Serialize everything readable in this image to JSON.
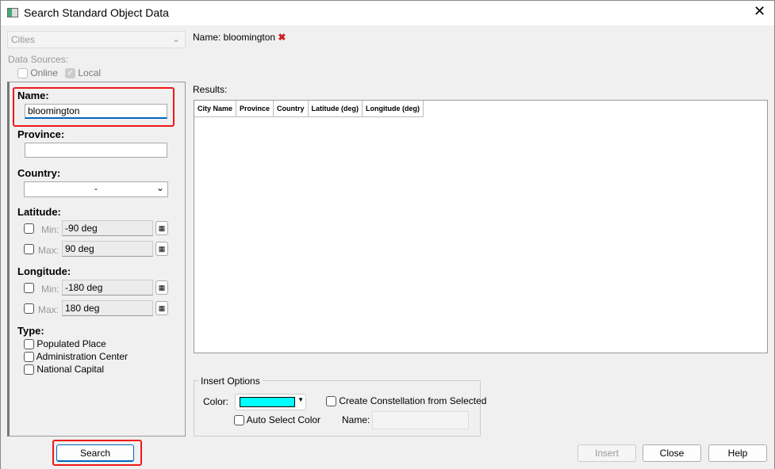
{
  "window": {
    "title": "Search Standard Object Data"
  },
  "category": {
    "selected": "Cities"
  },
  "data_sources": {
    "label": "Data Sources:",
    "online": "Online",
    "local": "Local",
    "local_checked": true,
    "online_checked": false
  },
  "form": {
    "name_label": "Name:",
    "name_value": "bloomington",
    "province_label": "Province:",
    "province_value": "",
    "country_label": "Country:",
    "country_value": "-",
    "latitude_label": "Latitude:",
    "min_label": "Min:",
    "max_label": "Max:",
    "lat_min": "-90 deg",
    "lat_max": "90 deg",
    "longitude_label": "Longitude:",
    "lon_min": "-180 deg",
    "lon_max": "180 deg",
    "type_label": "Type:",
    "types": [
      "Populated Place",
      "Administration Center",
      "National Capital"
    ]
  },
  "filter": {
    "text": "Name: bloomington"
  },
  "results": {
    "label": "Results:",
    "columns": [
      "City Name",
      "Province",
      "Country",
      "Latitude (deg)",
      "Longitude (deg)"
    ],
    "rows": []
  },
  "insert_options": {
    "legend": "Insert Options",
    "color_label": "Color:",
    "color": "#00ffff",
    "auto_select": "Auto Select Color",
    "constellation": "Create Constellation from Selected",
    "name_label": "Name:",
    "name_value": ""
  },
  "buttons": {
    "search": "Search",
    "insert": "Insert",
    "close": "Close",
    "help": "Help"
  }
}
